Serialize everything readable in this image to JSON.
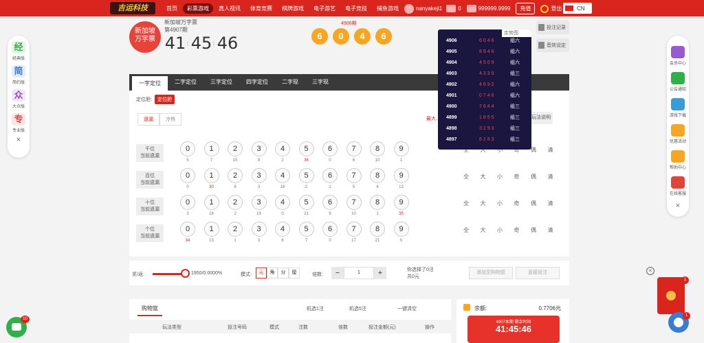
{
  "header": {
    "logo": "吉运科技",
    "nav": [
      "首页",
      "彩票游戏",
      "真人视讯",
      "体育竞赛",
      "棋牌游戏",
      "电子游艺",
      "电子竞技",
      "捕鱼游戏"
    ],
    "username": "nanyakeji1",
    "messages": "0",
    "balance": "999999.9999",
    "deposit_label": "充值",
    "logout_label": "登出",
    "language": "CN"
  },
  "game": {
    "logo": "新加坡\n万字票",
    "name": "新加坡万字票",
    "period": "第4907期",
    "timer": [
      "41",
      "45",
      "46"
    ],
    "last_period": "4906期",
    "last_balls": [
      "6",
      "0",
      "4",
      "6"
    ],
    "trend_label": "走势图",
    "bet_record": "投注记录",
    "sound_setting": "音效设定"
  },
  "history": [
    {
      "p": "4906",
      "d": "6046",
      "t": "组六"
    },
    {
      "p": "4905",
      "d": "8946",
      "t": "组六"
    },
    {
      "p": "4904",
      "d": "4509",
      "t": "组六"
    },
    {
      "p": "4903",
      "d": "4330",
      "t": "组三"
    },
    {
      "p": "4902",
      "d": "4692",
      "t": "组六"
    },
    {
      "p": "4901",
      "d": "0746",
      "t": "组六"
    },
    {
      "p": "4900",
      "d": "7644",
      "t": "组三"
    },
    {
      "p": "4899",
      "d": "1855",
      "t": "组三"
    },
    {
      "p": "4898",
      "d": "3293",
      "t": "组三"
    },
    {
      "p": "4897",
      "d": "6283",
      "t": "组三"
    }
  ],
  "tabs": [
    "一字定位",
    "二字定位",
    "三字定位",
    "四字定位",
    "二字现",
    "三字现"
  ],
  "sub": {
    "label": "定位胆:",
    "chip": "定位胆"
  },
  "miss_tabs": [
    "遗漏",
    "冷热"
  ],
  "help_link": "最大...",
  "play_desc": "玩法说明",
  "rows": [
    {
      "pos": "千位",
      "sub": "当前遗漏",
      "miss": [
        "5",
        "7",
        "15",
        "8",
        "2",
        "36",
        "0",
        "6",
        "10",
        "1"
      ]
    },
    {
      "pos": "百位",
      "sub": "当前遗漏",
      "miss": [
        "0",
        "30",
        "8",
        "3",
        "16",
        "2",
        "1",
        "5",
        "4",
        "13"
      ]
    },
    {
      "pos": "十位",
      "sub": "当前遗漏",
      "miss": [
        "3",
        "18",
        "2",
        "19",
        "0",
        "21",
        "9",
        "10",
        "1",
        "35"
      ]
    },
    {
      "pos": "个位",
      "sub": "当前遗漏",
      "miss": [
        "34",
        "13",
        "1",
        "3",
        "6",
        "7",
        "0",
        "17",
        "21",
        "5"
      ]
    }
  ],
  "hot_threshold": 30,
  "quick": [
    "全",
    "大",
    "小",
    "奇",
    "偶",
    "清"
  ],
  "bar": {
    "rebate_label": "奖/返:",
    "rebate_value": "1950/0.0000%",
    "rebate_fraction": 1.0,
    "mode_label": "模式:",
    "modes": [
      "元",
      "角",
      "分",
      "厘"
    ],
    "times_label": "倍数:",
    "times_value": "1",
    "minus": "−",
    "plus": "+",
    "selected": "你选择了0注",
    "total": "共0元",
    "add_cart": "添加至购物篮",
    "quick_bet": "直接投注"
  },
  "cart": {
    "title": "购物篮",
    "random1": "机选1注",
    "random5": "机选5注",
    "clear": "一键清空",
    "headers": [
      "玩法类型",
      "投注号码",
      "模式",
      "注数",
      "倍数",
      "投注金额(元)",
      "操作"
    ]
  },
  "balance": {
    "label": "余额:",
    "value": "0.7706元",
    "panel_title": "4907本期 剩余时间",
    "panel_time": "41:45:46"
  },
  "left_side": [
    {
      "icon": "经",
      "label": "经典版",
      "color": "#2fb04a"
    },
    {
      "icon": "简",
      "label": "简约版",
      "color": "#3a7bd5"
    },
    {
      "icon": "众",
      "label": "大众版",
      "color": "#9b4bd0"
    },
    {
      "icon": "专",
      "label": "专业版",
      "color": "#e0453a"
    }
  ],
  "right_side": [
    {
      "label": "会员中心",
      "color": "#9b59d0"
    },
    {
      "label": "公告通知",
      "color": "#2fb04a"
    },
    {
      "label": "游戏下载",
      "color": "#3a9bd5"
    },
    {
      "label": "优惠活动",
      "color": "#f5a623"
    },
    {
      "label": "帮助中心",
      "color": "#f5a623"
    },
    {
      "label": "在线客服",
      "color": "#e0453a"
    }
  ],
  "close": "×",
  "badges": {
    "red_packet": "1",
    "chat": "1",
    "wechat": "10"
  }
}
